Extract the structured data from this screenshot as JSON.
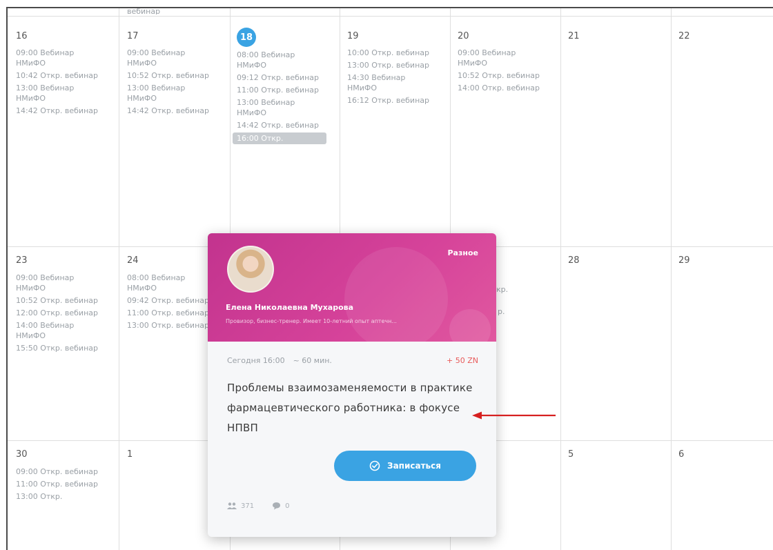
{
  "calendar": {
    "top_fragment": "вебинар",
    "week1": [
      {
        "day": "16",
        "today": false,
        "events": [
          "09:00 Вебинар НМиФО",
          "10:42 Откр. вебинар",
          "13:00 Вебинар НМиФО",
          "14:42 Откр. вебинар"
        ]
      },
      {
        "day": "17",
        "today": false,
        "events": [
          "09:00 Вебинар НМиФО",
          "10:52 Откр. вебинар",
          "13:00 Вебинар НМиФО",
          "14:42 Откр. вебинар"
        ]
      },
      {
        "day": "18",
        "today": true,
        "events": [
          "08:00 Вебинар НМиФО",
          "09:12 Откр. вебинар",
          "11:00 Откр. вебинар",
          "13:00 Вебинар НМиФО",
          "14:42 Откр. вебинар"
        ],
        "highlight": "16:00 Откр."
      },
      {
        "day": "19",
        "today": false,
        "events": [
          "10:00 Откр. вебинар",
          "13:00 Откр. вебинар",
          "14:30 Вебинар НМиФО",
          "16:12 Откр. вебинар"
        ]
      },
      {
        "day": "20",
        "today": false,
        "events": [
          "09:00 Вебинар НМиФО",
          "10:52 Откр. вебинар",
          "14:00 Откр. вебинар"
        ]
      },
      {
        "day": "21",
        "today": false,
        "events": []
      },
      {
        "day": "22",
        "today": false,
        "events": []
      }
    ],
    "week2": [
      {
        "day": "23",
        "events": [
          "09:00 Вебинар НМиФО",
          "10:52 Откр. вебинар",
          "12:00 Откр. вебинар",
          "14:00 Вебинар НМиФО",
          "15:50 Откр. вебинар"
        ]
      },
      {
        "day": "24",
        "events": [
          "08:00 Вебинар НМиФО",
          "09:42 Откр. вебинар",
          "11:00 Откр. вебинар",
          "13:00 Откр. вебинар"
        ]
      },
      {
        "day": "28",
        "events": []
      },
      {
        "day": "29",
        "events": []
      },
      {
        "partial": "кр.",
        "partial2": "р."
      }
    ],
    "week3": [
      {
        "day": "30",
        "events": [
          "09:00 Откр. вебинар",
          "11:00 Откр. вебинар",
          "13:00 Откр."
        ]
      },
      {
        "day": "1",
        "events": []
      },
      {
        "day": "5",
        "events": []
      },
      {
        "day": "6",
        "events": []
      }
    ]
  },
  "popup": {
    "category": "Разное",
    "speaker_name": "Елена Николаевна Мухарова",
    "speaker_desc": "Провизор, бизнес-тренер. Имеет 10-летний опыт аптечн...",
    "date_time": "Сегодня 16:00",
    "duration": "~ 60 мин.",
    "points": "+ 50 ZN",
    "title": "Проблемы взаимозаменяемости в практике фармацевтического работника: в фокусе НПВП",
    "join_label": "Записаться",
    "participants": "371",
    "comments": "0",
    "colors": {
      "header": "#d6439a",
      "button": "#3aa3e3",
      "points": "#e85a5a"
    }
  }
}
